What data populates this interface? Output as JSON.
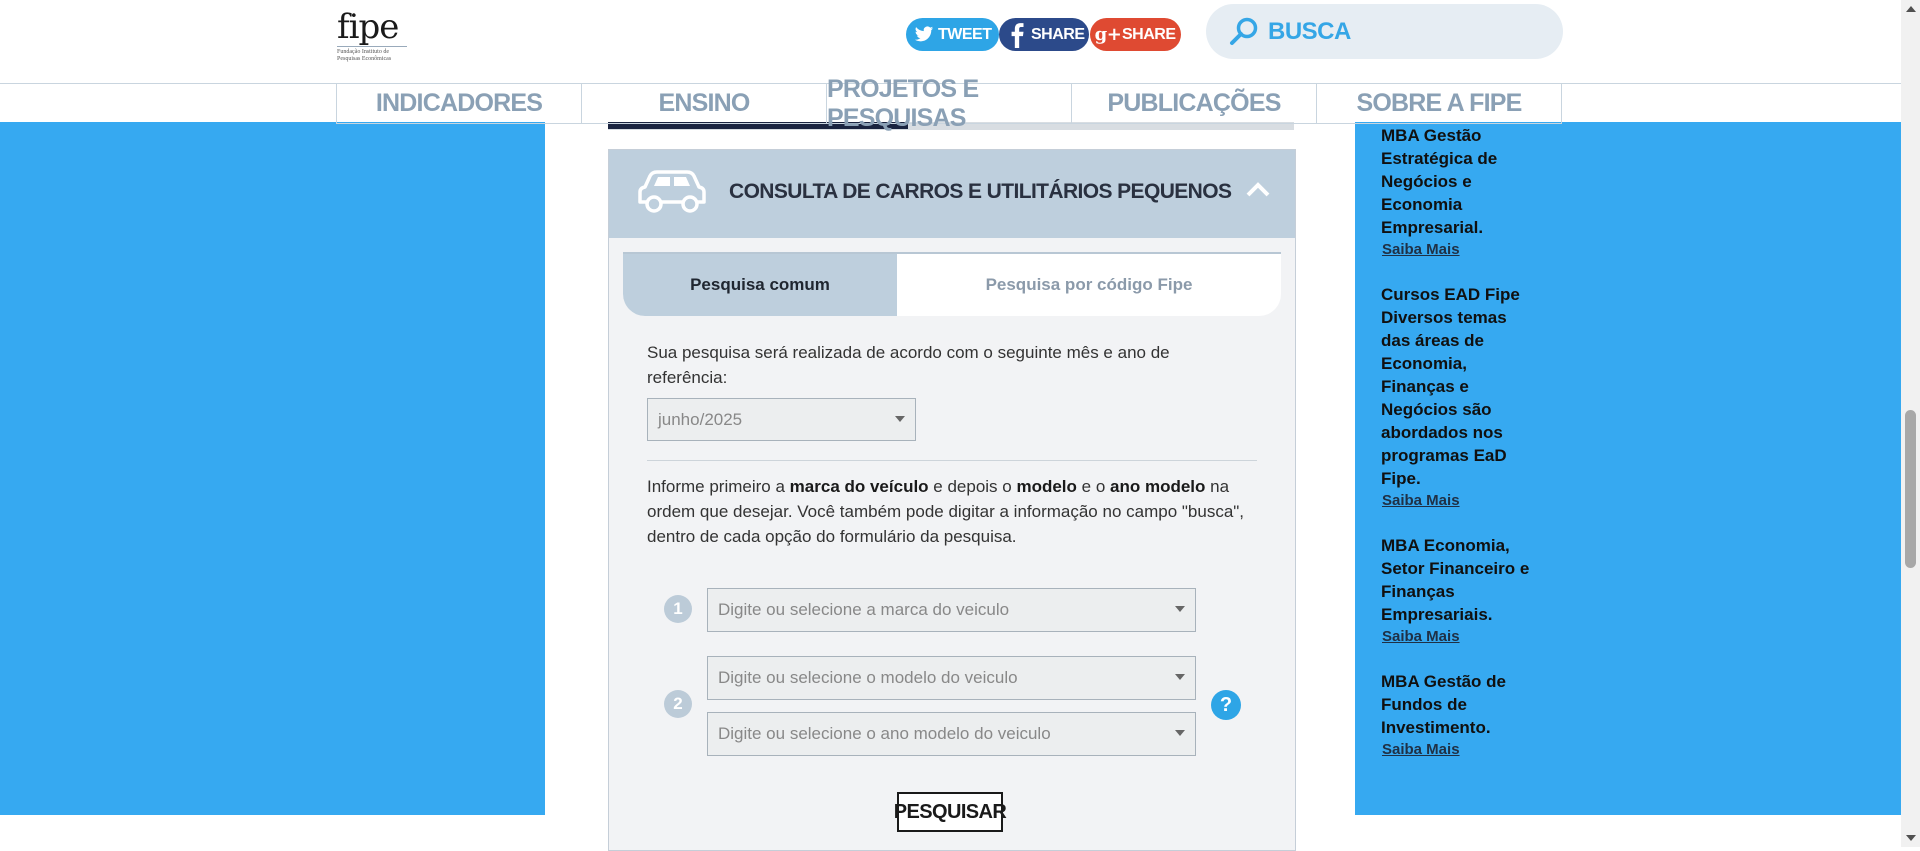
{
  "header": {
    "logo": {
      "word": "fipe",
      "subtitle_line1": "Fundação Instituto de",
      "subtitle_line2": "Pesquisas Econômicas"
    },
    "social": [
      {
        "label": "TWEET",
        "icon": "twitter-icon",
        "color": "#2ea5e6"
      },
      {
        "label": "SHARE",
        "icon": "facebook-icon",
        "color": "#2c4a8a"
      },
      {
        "label": "SHARE",
        "icon": "google-plus-icon",
        "color": "#df4a32"
      }
    ],
    "search": {
      "label": "BUSCA",
      "icon": "search-icon"
    },
    "nav": [
      "INDICADORES",
      "ENSINO",
      "PROJETOS E PESQUISAS",
      "PUBLICAÇÕES",
      "SOBRE A FIPE"
    ]
  },
  "panel": {
    "title": "CONSULTA DE CARROS E UTILITÁRIOS PEQUENOS",
    "tabs": {
      "common": "Pesquisa comum",
      "by_code": "Pesquisa por código Fipe"
    },
    "ref_text": "Sua pesquisa será realizada de acordo com o seguinte mês e ano de referência:",
    "ref_select": "junho/2025",
    "info": {
      "part1": "Informe primeiro a ",
      "bold1": "marca do veículo",
      "part2": " e depois o ",
      "bold2": "modelo",
      "part3": " e o ",
      "bold3": "ano modelo",
      "part4": " na ordem que desejar. Você também pode digitar a informação no campo \"busca\", dentro de cada opção do formulário da pesquisa."
    },
    "steps": [
      "1",
      "2"
    ],
    "fields": {
      "brand": "Digite ou selecione a marca do veiculo",
      "model": "Digite ou selecione o modelo do veiculo",
      "year": "Digite ou selecione o ano modelo do veiculo"
    },
    "help": "?",
    "button": "PESQUISAR"
  },
  "sidebar": [
    {
      "title": "MBA Gestão Estratégica de Negócios e Economia Empresarial.",
      "link": "Saiba Mais"
    },
    {
      "title": "Cursos EAD Fipe Diversos temas das áreas de Economia, Finanças e Negócios são abordados nos programas EaD Fipe.",
      "link": "Saiba Mais"
    },
    {
      "title": "MBA Economia, Setor Financeiro e Finanças Empresariais.",
      "link": "Saiba Mais"
    },
    {
      "title": "MBA Gestão de Fundos de Investimento.",
      "link": "Saiba Mais"
    }
  ],
  "colors": {
    "accent": "#36a9f1",
    "panel_head": "#becfdd",
    "nav_text": "#8aa0b5"
  }
}
